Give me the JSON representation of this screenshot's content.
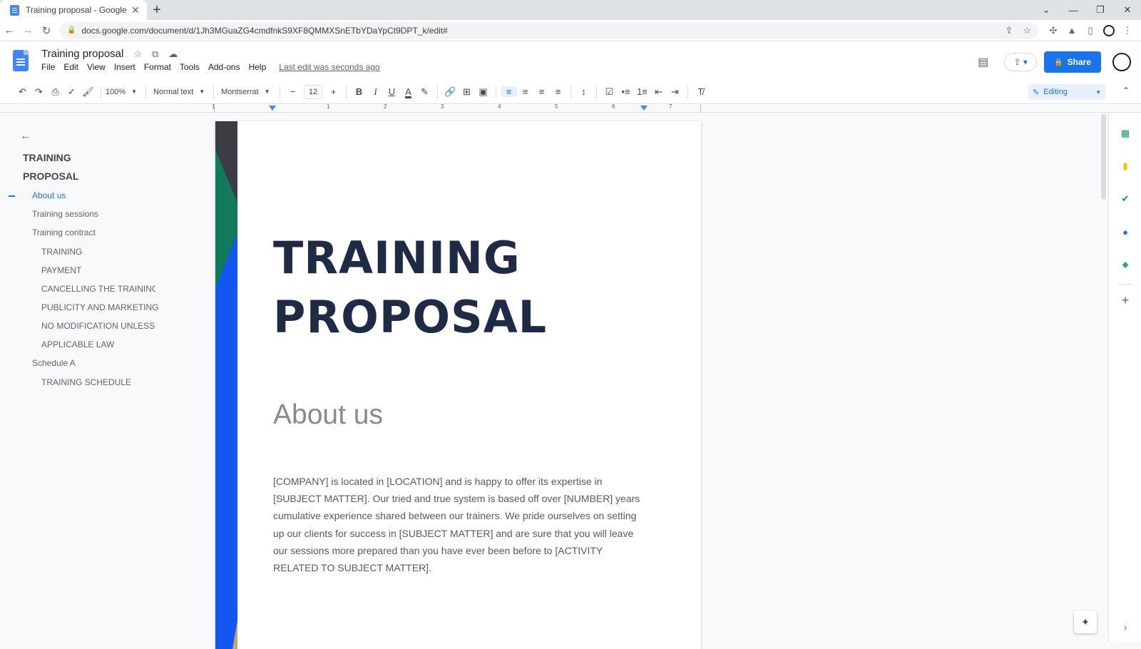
{
  "browser": {
    "tab_title": "Training proposal - Google Docs",
    "tab_close": "✕",
    "new_tab": "+",
    "url": "docs.google.com/document/d/1Jh3MGuaZG4cmdfnkS9XF8QMMXSnETbYDaYpCt9DPT_k/edit#"
  },
  "docs": {
    "title": "Training proposal",
    "menu": [
      "File",
      "Edit",
      "View",
      "Insert",
      "Format",
      "Tools",
      "Add-ons",
      "Help"
    ],
    "last_edit": "Last edit was seconds ago",
    "share_label": "Share"
  },
  "toolbar": {
    "zoom": "100%",
    "style": "Normal text",
    "font": "Montserrat",
    "font_size": "12",
    "bold": "B",
    "italic": "I",
    "underline": "U",
    "text_color": "A",
    "mode": "Editing"
  },
  "ruler": {
    "numbers": [
      "1",
      "1",
      "2",
      "3",
      "4",
      "5",
      "6",
      "7"
    ]
  },
  "outline": {
    "items": [
      "TRAINING",
      "PROPOSAL",
      "About us",
      "Training sessions",
      "Training contract",
      "TRAINING",
      "PAYMENT",
      "CANCELLING THE TRAINING...",
      "PUBLICITY AND MARKETING",
      "NO MODIFICATION UNLESS I...",
      "APPLICABLE LAW",
      "Schedule A",
      "TRAINING SCHEDULE"
    ]
  },
  "document": {
    "title_line1": "TRAINING",
    "title_line2": "PROPOSAL",
    "heading": "About us",
    "body": "[COMPANY] is located in [LOCATION] and is happy to offer its expertise in [SUBJECT MATTER]. Our tried and true system is based off over [NUMBER] years cumulative experience shared between our trainers. We pride ourselves on setting up our clients for success in [SUBJECT MATTER] and are sure that you will leave our sessions more prepared than you have ever been before to [ACTIVITY RELATED TO SUBJECT MATTER]."
  },
  "colors": {
    "accent": "#1a73e8",
    "title_text": "#1f2a44",
    "deco_dark": "#3c3c44",
    "deco_green": "#127a5c",
    "deco_blue": "#1457f0"
  },
  "icons": {
    "side_panel": [
      "sheets-icon",
      "keep-icon",
      "tasks-icon",
      "contacts-icon",
      "maps-icon",
      "add-icon"
    ]
  }
}
